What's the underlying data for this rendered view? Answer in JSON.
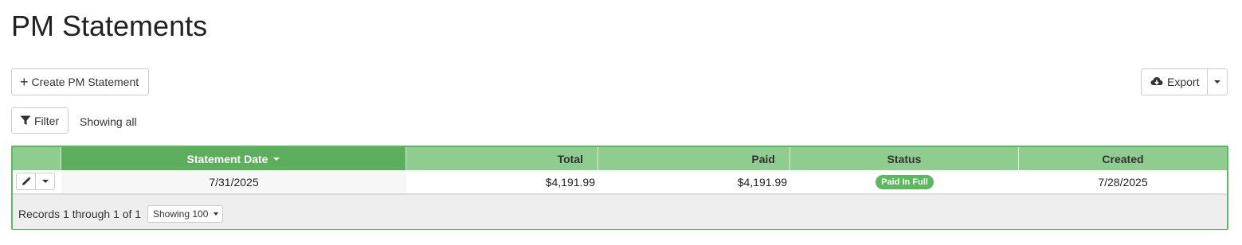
{
  "page": {
    "title": "PM Statements"
  },
  "toolbar": {
    "create_label": "Create PM Statement",
    "create_icon": "plus-icon",
    "export_label": "Export",
    "export_icon": "cloud-download-icon"
  },
  "filter": {
    "label": "Filter",
    "icon": "filter-icon",
    "status_text": "Showing all"
  },
  "table": {
    "columns": [
      {
        "label": "",
        "align": "left"
      },
      {
        "label": "Statement Date",
        "align": "center",
        "sorted": "desc"
      },
      {
        "label": "Total",
        "align": "right"
      },
      {
        "label": "Paid",
        "align": "right"
      },
      {
        "label": "Status",
        "align": "center"
      },
      {
        "label": "Created",
        "align": "center"
      }
    ],
    "rows": [
      {
        "statement_date": "7/31/2025",
        "total": "$4,191.99",
        "paid": "$4,191.99",
        "status": "Paid In Full",
        "created": "7/28/2025"
      }
    ],
    "footer": {
      "records_text": "Records 1 through 1 of 1",
      "page_size_label": "Showing 100"
    }
  },
  "colors": {
    "grid_border": "#5cb85c",
    "header_bg": "#8fcc8f",
    "sorted_header_bg": "#5cad5c",
    "status_badge": "#5cb85c"
  }
}
